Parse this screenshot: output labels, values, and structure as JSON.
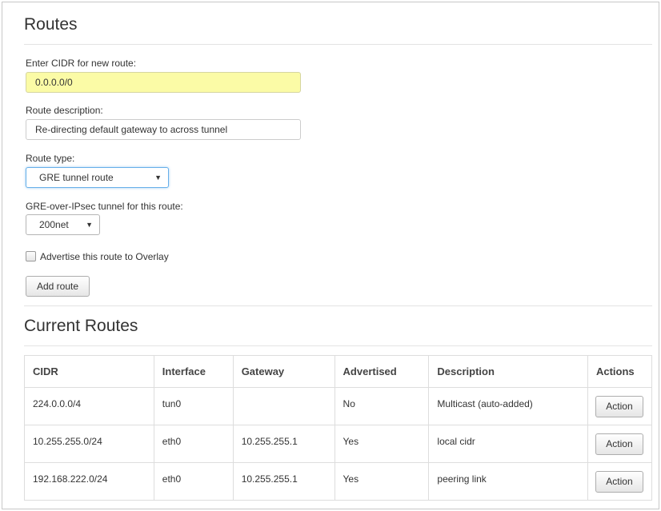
{
  "routes_form": {
    "title": "Routes",
    "cidr_label": "Enter CIDR for new route:",
    "cidr_value": "0.0.0.0/0",
    "description_label": "Route description:",
    "description_value": "Re-directing default gateway to across tunnel",
    "route_type_label": "Route type:",
    "route_type_value": "GRE tunnel route",
    "tunnel_label": "GRE-over-IPsec tunnel for this route:",
    "tunnel_value": "200net",
    "advertise_label": "Advertise this route to Overlay",
    "advertise_checked": false,
    "add_button": "Add route"
  },
  "current_routes": {
    "title": "Current Routes",
    "columns": [
      "CIDR",
      "Interface",
      "Gateway",
      "Advertised",
      "Description",
      "Actions"
    ],
    "rows": [
      {
        "cidr": "224.0.0.0/4",
        "interface": "tun0",
        "gateway": "",
        "advertised": "No",
        "description": "Multicast (auto-added)",
        "action": "Action"
      },
      {
        "cidr": "10.255.255.0/24",
        "interface": "eth0",
        "gateway": "10.255.255.1",
        "advertised": "Yes",
        "description": "local cidr",
        "action": "Action"
      },
      {
        "cidr": "192.168.222.0/24",
        "interface": "eth0",
        "gateway": "10.255.255.1",
        "advertised": "Yes",
        "description": "peering link",
        "action": "Action"
      }
    ]
  },
  "icons": {
    "dropdown": "chevron-down-icon",
    "checkbox": "checkbox-icon"
  },
  "colors": {
    "highlight_input": "#fbfba6",
    "focus_border": "#66afe9",
    "border": "#dddddd"
  }
}
